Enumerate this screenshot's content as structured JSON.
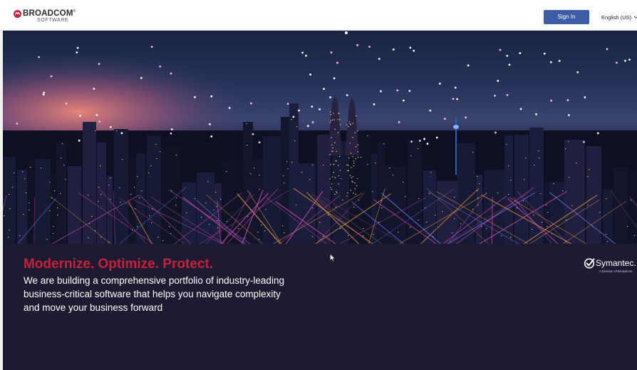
{
  "header": {
    "logo": {
      "wordmark": "BROADCOM",
      "trademark": "®",
      "subtitle": "SOFTWARE",
      "mark_color": "#c9203a"
    },
    "sign_in_label": "Sign In",
    "sign_in_color": "#3d5ca6",
    "language": {
      "selected": "English (US)",
      "icon": "chevron-down-icon"
    }
  },
  "hero": {
    "image": "night-city-skyline-with-light-beams"
  },
  "banner": {
    "background_color": "#1c1b32",
    "headline": "Modernize. Optimize. Protect.",
    "headline_color": "#c9203a",
    "description": "We are building a comprehensive portfolio of industry-leading business-critical software that helps you navigate complexity and move your business forward",
    "partner": {
      "name": "Symantec",
      "tm": ".",
      "tagline": "A Division of Broadcom",
      "icon": "checkmark-circle-icon"
    }
  }
}
